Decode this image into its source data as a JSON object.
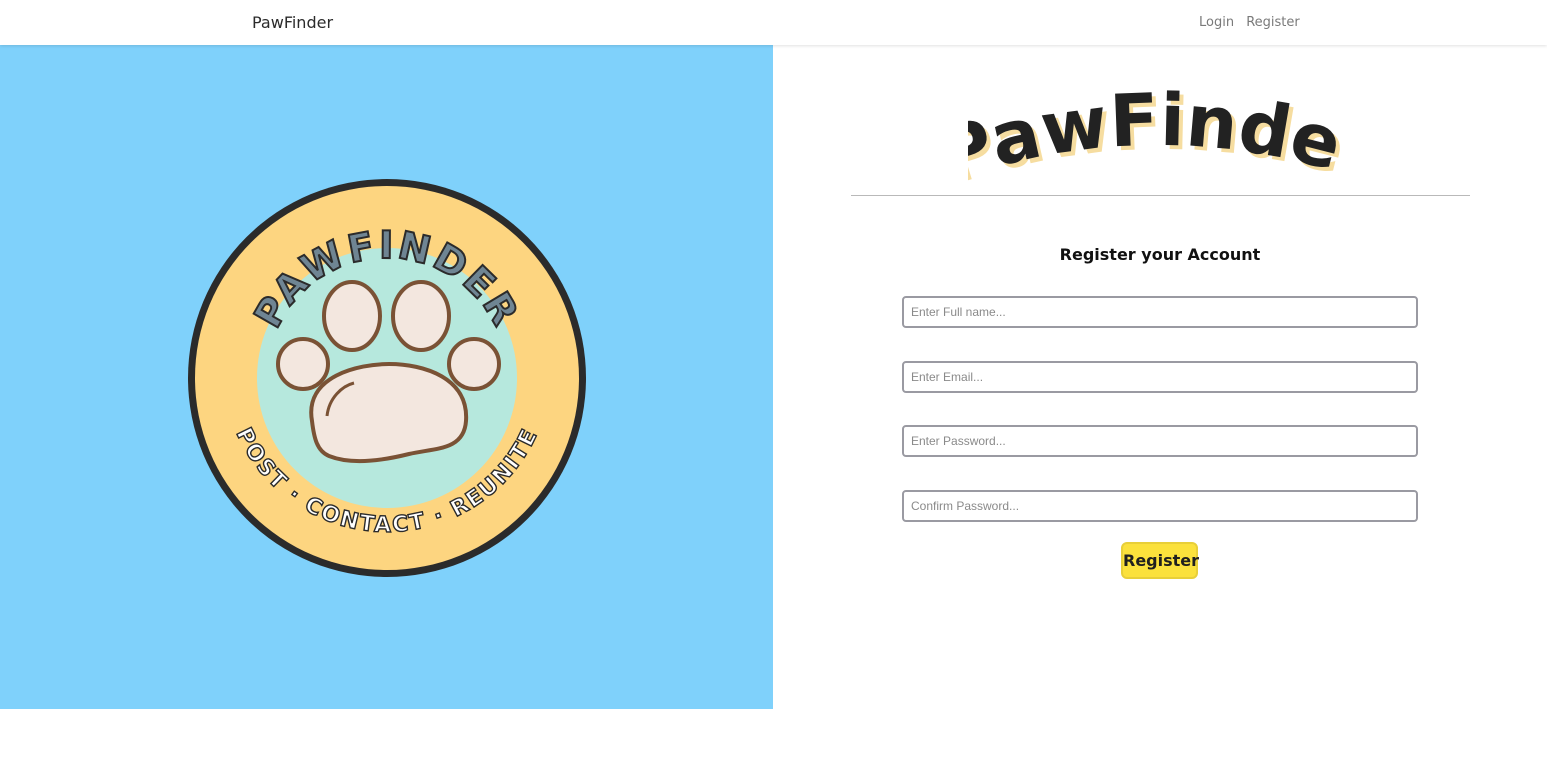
{
  "nav": {
    "brand": "PawFinder",
    "login": "Login",
    "register": "Register"
  },
  "hero": {
    "badge_top_text": "PAWFINDER",
    "badge_bottom_text": "POST · CONTACT · REUNITE"
  },
  "logo": {
    "text": "PawFinder"
  },
  "form": {
    "title": "Register your Account",
    "full_name_placeholder": "Enter Full name...",
    "email_placeholder": "Enter Email...",
    "password_placeholder": "Enter Password...",
    "confirm_placeholder": "Confirm Password...",
    "submit_label": "Register"
  },
  "colors": {
    "hero_bg": "#7fd1fb",
    "badge_ring": "#fdd580",
    "badge_center": "#b6e8dd",
    "paw_fill": "#f3e7df",
    "paw_stroke": "#7a5235",
    "button_bg": "#fbe13c"
  }
}
